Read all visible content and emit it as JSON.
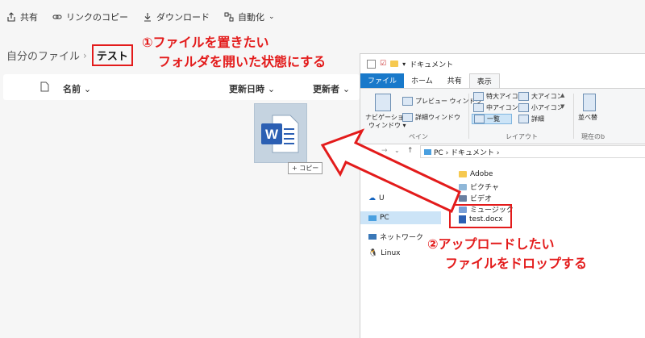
{
  "commandbar": {
    "share": "共有",
    "copy_link": "リンクのコピー",
    "download": "ダウンロード",
    "automate": "自動化"
  },
  "breadcrumb": {
    "root": "自分のファイル",
    "current": "テスト"
  },
  "list_header": {
    "name": "名前",
    "modified": "更新日時",
    "modified_by": "更新者"
  },
  "annotations": {
    "step1_line1": "①ファイルを置きたい",
    "step1_line2": "フォルダを開いた状態にする",
    "step2_line1": "②アップロードしたい",
    "step2_line2": "ファイルをドロップする"
  },
  "drag": {
    "copy_label": "+ コピー",
    "icon": "word-doc-icon"
  },
  "explorer": {
    "title": "ドキュメント",
    "tabs": [
      "ファイル",
      "ホーム",
      "共有",
      "表示"
    ],
    "ribbon": {
      "nav_pane": "ナビゲーション",
      "nav_pane2": "ウィンドウ ▾",
      "preview": "プレビュー ウィンドウ",
      "details": "詳細ウィンドウ",
      "xl_icons": "特大アイコン",
      "l_icons": "大アイコン",
      "m_icons": "中アイコン",
      "s_icons": "小アイコン",
      "list": "一覧",
      "detail_view": "詳細",
      "sort": "並べ替",
      "group_pane": "ペイン",
      "group_layout": "レイアウト",
      "group_current": "現在のb"
    },
    "address": "PC  ›  ドキュメント  ›",
    "nav": {
      "partial1": "セス",
      "partial2": "U",
      "pc": "PC",
      "network": "ネットワーク",
      "linux": "Linux"
    },
    "files": [
      "Adobe",
      "ピクチャ",
      "ビデオ",
      "ミュージック",
      "test.docx"
    ]
  },
  "colors": {
    "annotation_red": "#e31b1b",
    "word_blue": "#2b5fb3",
    "file_tab": "#1979ca"
  }
}
